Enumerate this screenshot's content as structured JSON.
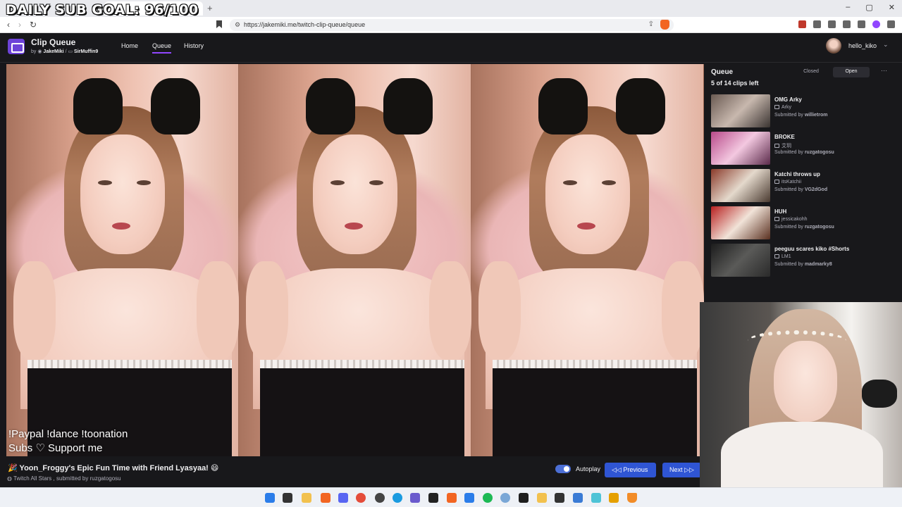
{
  "overlay": {
    "goal_text": "DAILY SUB GOAL: 96/100"
  },
  "browser": {
    "tab_close": "×",
    "new_tab": "+",
    "url": "https://jakemiki.me/twitch-clip-queue/queue",
    "window_controls": [
      "–",
      "▢",
      "✕"
    ]
  },
  "header": {
    "app_title": "Clip Queue",
    "by_label": "by",
    "author_1": "JakeMiki",
    "separator": "/",
    "author_2": "SirMuffin9",
    "nav": [
      "Home",
      "Queue",
      "History"
    ],
    "username": "hello_kiko",
    "user_chevron": "⌄"
  },
  "video": {
    "caption_line1": "!Paypal !dance !toonation",
    "caption_line2": "Subs ♡ Support me"
  },
  "now_playing": {
    "title": "🎉 Yoon_Froggy's Epic Fun Time with Friend Lyasyaa! 😄",
    "channel": "Twitch All Stars",
    "submitted_prefix": ", submitted by",
    "submitter": "ruzgatogosu",
    "autoplay_label": "Autoplay",
    "autoplay_on": true,
    "previous_label": "Previous",
    "next_label": "Next"
  },
  "queue": {
    "title": "Queue",
    "closed_label": "Closed",
    "open_label": "Open",
    "more": "···",
    "count_text": "5 of 14 clips left",
    "submitted_by_label": "Submitted by",
    "items": [
      {
        "title": "OMG Arky",
        "channel": "Arky",
        "submitter": "willietrom",
        "thumb": [
          "#6a5a52",
          "#c8b8ae",
          "#3a3431"
        ]
      },
      {
        "title": "BROKE",
        "channel": "艾玥",
        "submitter": "ruzgatogosu",
        "thumb": [
          "#b84a8a",
          "#f3c8e0",
          "#5a2a4a"
        ]
      },
      {
        "title": "Katchi throws up",
        "channel": "itsKatchii",
        "submitter": "VG2dGod",
        "thumb": [
          "#8b3a2a",
          "#e4d9cc",
          "#4a3a30"
        ]
      },
      {
        "title": "HUH",
        "channel": "jessicakohh",
        "submitter": "ruzgatogosu",
        "thumb": [
          "#b82020",
          "#f1e3d8",
          "#5a3020"
        ]
      },
      {
        "title": "peeguu scares kiko #Shorts",
        "channel": "LM1",
        "submitter": "madmarky8",
        "thumb": [
          "#1c1c1c",
          "#5a5a58",
          "#2a2a2a"
        ]
      }
    ]
  }
}
